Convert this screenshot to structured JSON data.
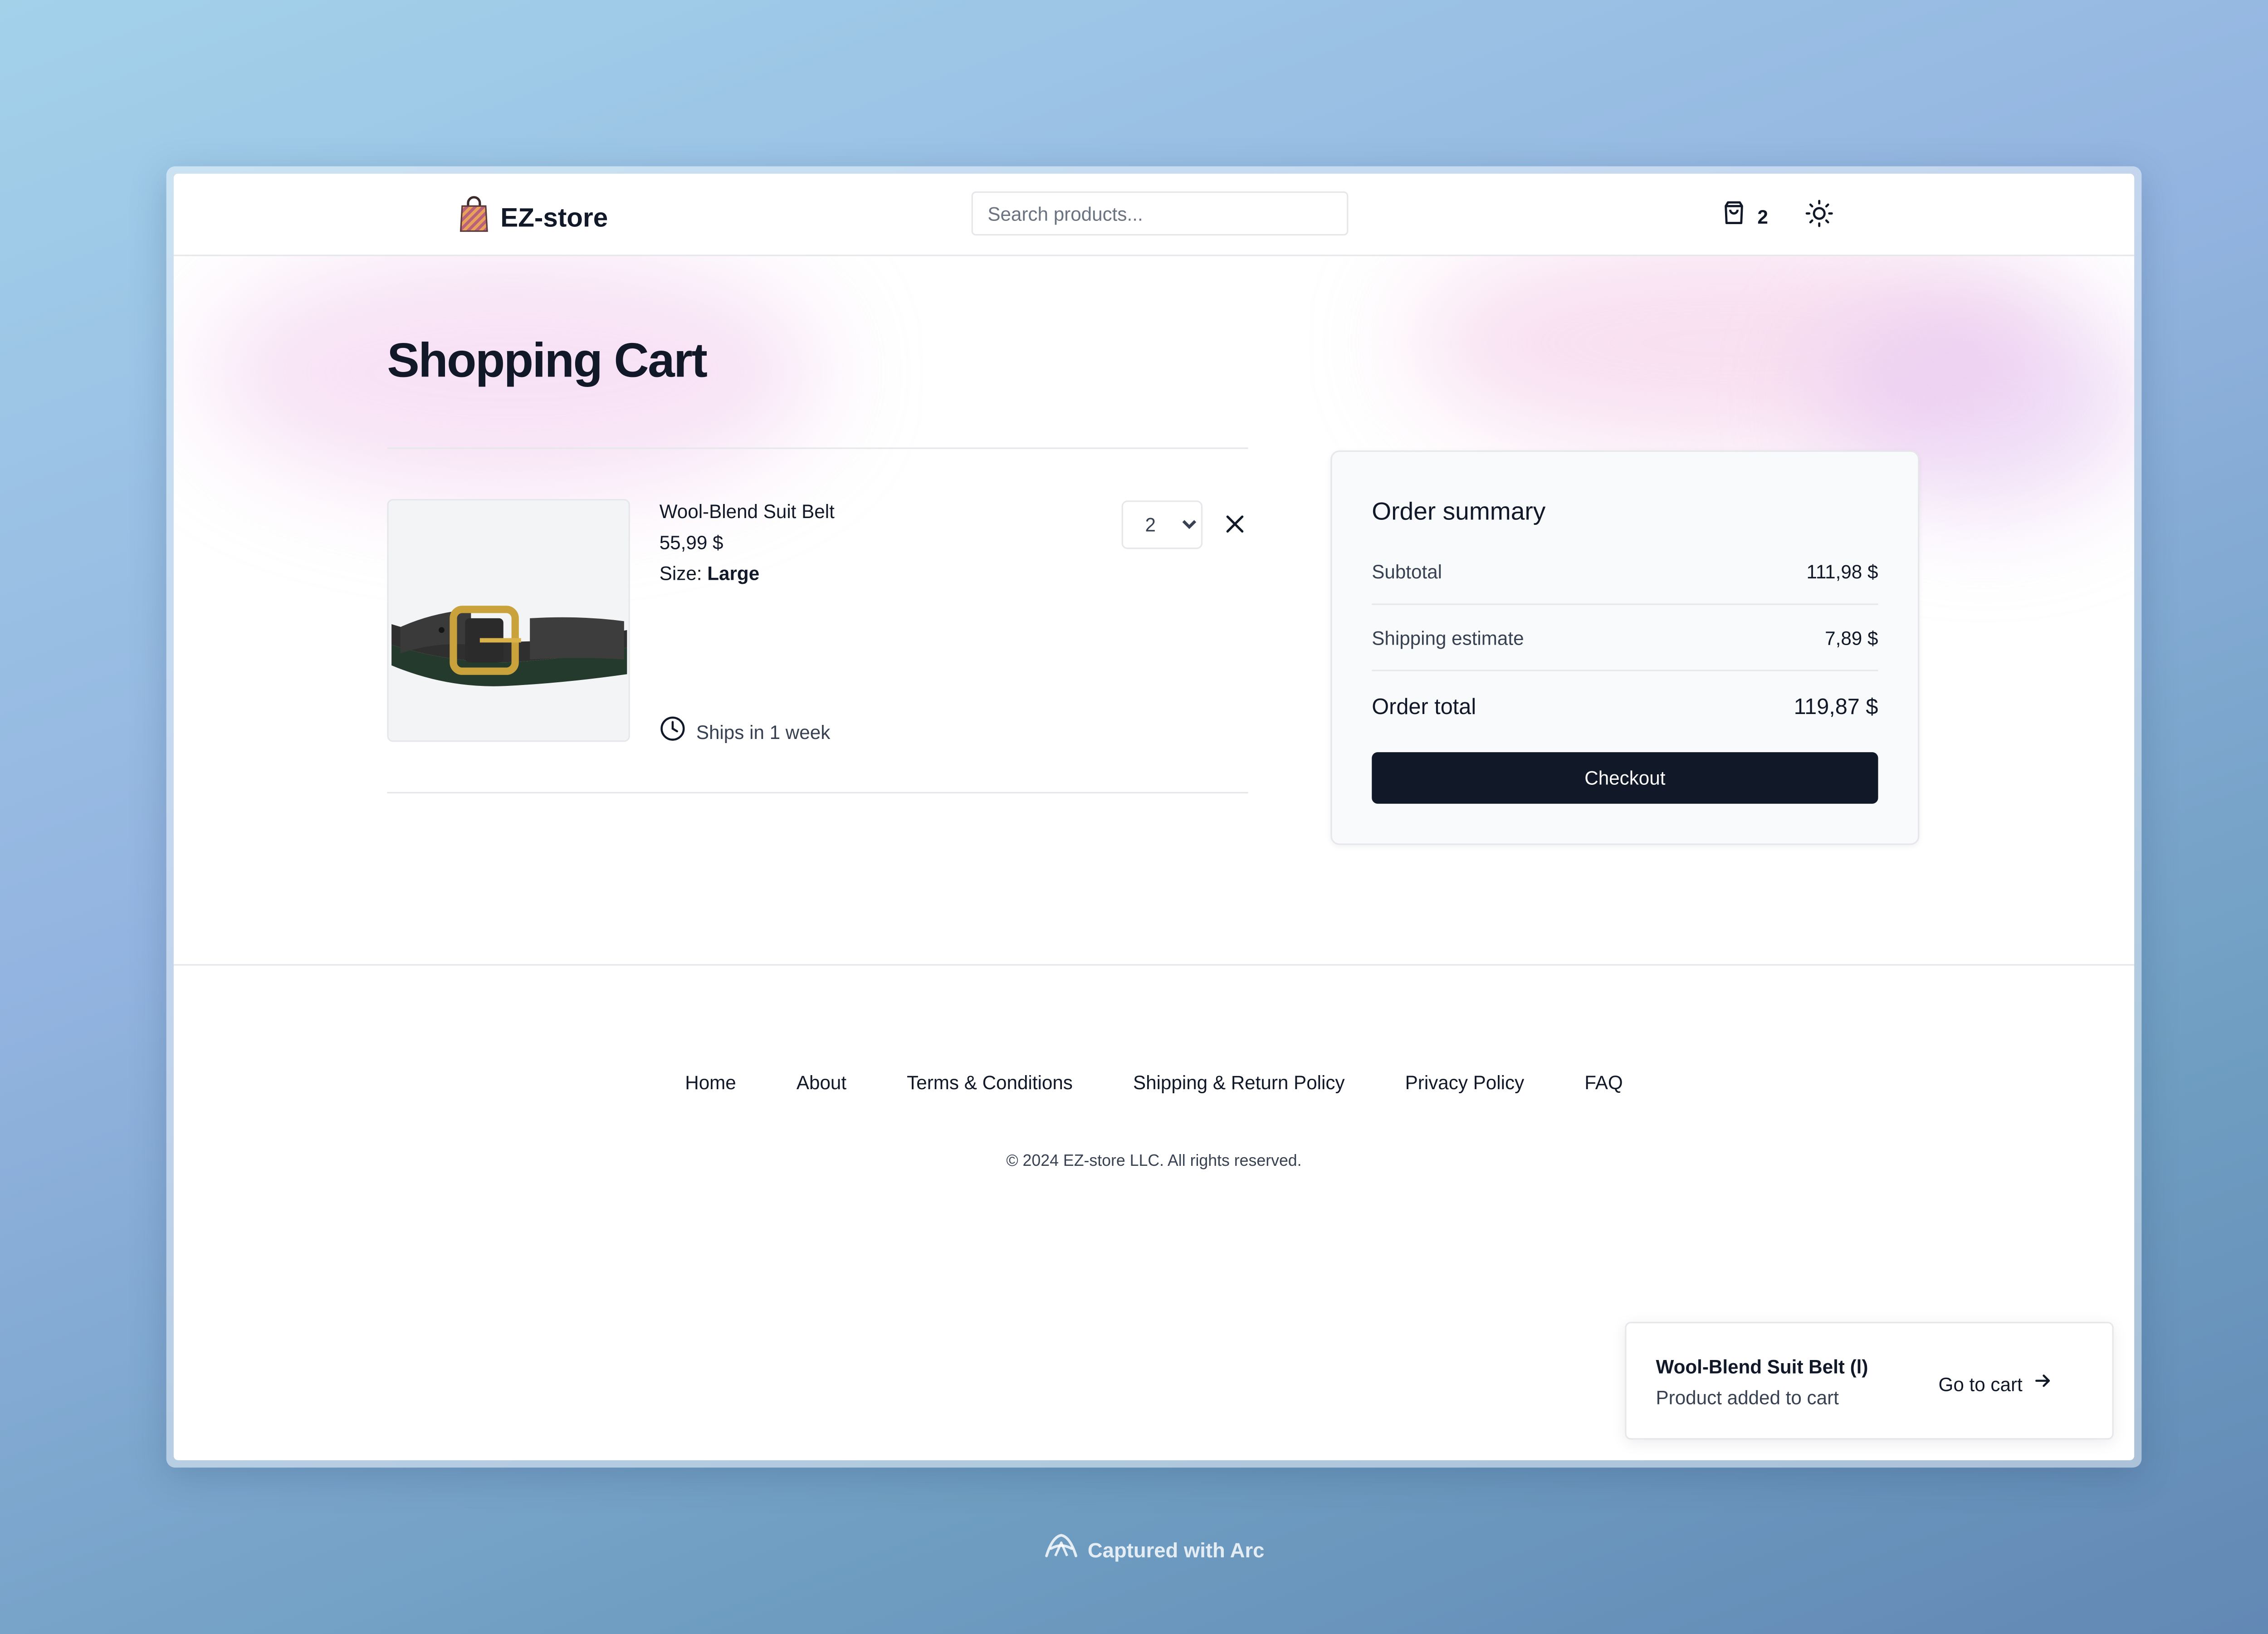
{
  "header": {
    "store_name": "EZ-store",
    "search_placeholder": "Search products...",
    "cart_count": "2"
  },
  "page": {
    "title": "Shopping Cart"
  },
  "cart": {
    "items": [
      {
        "name": "Wool-Blend Suit Belt",
        "price": "55,99 $",
        "size_label": "Size:",
        "size_value": "Large",
        "quantity": "2",
        "shipping_note": "Ships in 1 week"
      }
    ]
  },
  "summary": {
    "title": "Order summary",
    "subtotal_label": "Subtotal",
    "subtotal_value": "111,98 $",
    "shipping_label": "Shipping estimate",
    "shipping_value": "7,89 $",
    "total_label": "Order total",
    "total_value": "119,87 $",
    "checkout_label": "Checkout"
  },
  "footer": {
    "links": [
      "Home",
      "About",
      "Terms & Conditions",
      "Shipping & Return Policy",
      "Privacy Policy",
      "FAQ"
    ],
    "copyright": "© 2024 EZ-store LLC. All rights reserved."
  },
  "toast": {
    "title": "Wool-Blend Suit Belt (l)",
    "message": "Product added to cart",
    "action_label": "Go to cart"
  },
  "capture": {
    "label": "Captured with Arc"
  },
  "colors": {
    "primary_button": "#111827",
    "border": "#e5e7eb",
    "summary_bg": "#f9fafb"
  }
}
